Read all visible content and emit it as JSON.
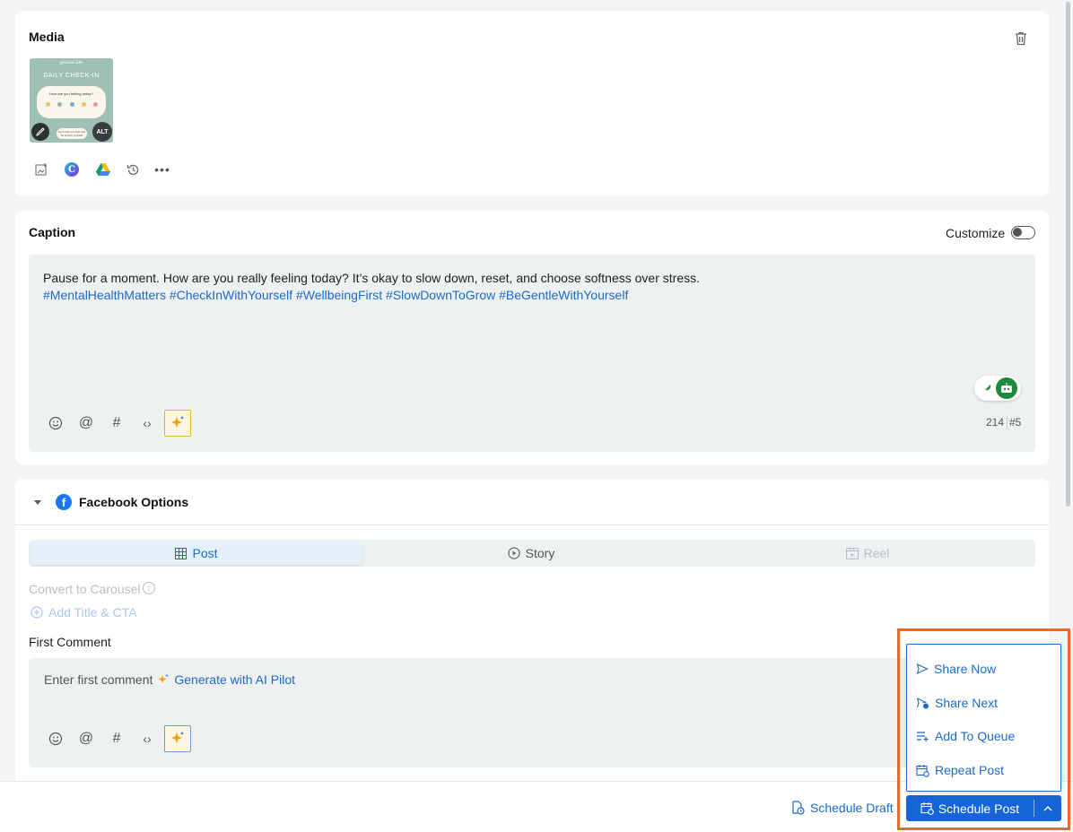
{
  "media": {
    "title": "Media",
    "thumb_brand": "gentle life",
    "thumb_heading": "DAILY CHECK-IN",
    "thumb_question": "How are you feeling today?",
    "thumb_footer": "Feel what you feel and be kind to yourself",
    "alt_badge": "ALT",
    "tool_icons": [
      "add-image-icon",
      "canva-icon",
      "google-drive-icon",
      "history-icon",
      "more-icon"
    ]
  },
  "caption": {
    "title": "Caption",
    "customize_label": "Customize",
    "text": "Pause for a moment. How are you really feeling today? It’s okay to slow down, reset, and choose softness over stress.",
    "hashtags": "#MentalHealthMatters #CheckInWithYourself #WellbeingFirst #SlowDownToGrow #BeGentleWithYourself",
    "char_count": "214",
    "hashtag_count": "#5"
  },
  "facebook": {
    "title": "Facebook Options",
    "tabs": [
      {
        "label": "Post",
        "icon": "grid-icon",
        "active": true
      },
      {
        "label": "Story",
        "icon": "play-circle-icon",
        "active": false
      },
      {
        "label": "Reel",
        "icon": "reel-icon",
        "active": false
      }
    ],
    "convert_carousel_label": "Convert to Carousel",
    "add_title_cta_label": "Add Title & CTA",
    "first_comment_label": "First Comment",
    "first_comment_placeholder": "Enter first comment",
    "generate_ai_label": "Generate with AI Pilot"
  },
  "footer": {
    "schedule_draft_label": "Schedule Draft",
    "schedule_post_label": "Schedule Post",
    "menu": [
      {
        "label": "Share Now",
        "icon": "send-icon"
      },
      {
        "label": "Share Next",
        "icon": "send-clock-icon"
      },
      {
        "label": "Add To Queue",
        "icon": "queue-add-icon"
      },
      {
        "label": "Repeat Post",
        "icon": "calendar-repeat-icon"
      }
    ]
  },
  "colors": {
    "accent": "#1b6ac9",
    "highlight_border": "#f26722",
    "primary_button": "#1565d8"
  }
}
